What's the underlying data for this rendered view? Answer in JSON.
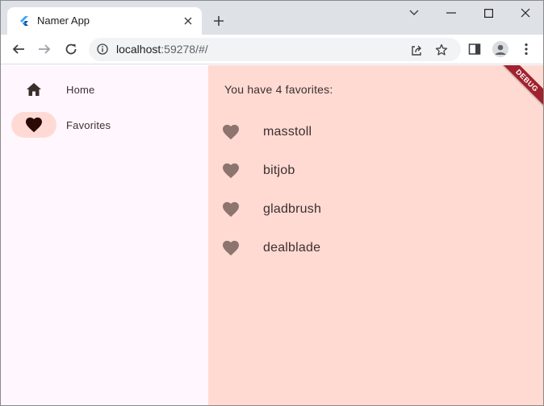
{
  "browser": {
    "tab_title": "Namer App",
    "url_host": "localhost",
    "url_rest": ":59278/#/"
  },
  "icons": {
    "favicon": "flutter-icon",
    "tab_close": "close-icon",
    "new_tab": "plus-icon",
    "minimize": "minimize-icon",
    "maximize": "maximize-icon",
    "close_window": "close-icon",
    "back": "back-arrow-icon",
    "forward": "forward-arrow-icon",
    "reload": "reload-icon",
    "site_info": "info-icon",
    "share": "share-icon",
    "bookmark": "star-icon",
    "side_panel": "side-panel-icon",
    "profile": "profile-icon",
    "menu": "kebab-menu-icon",
    "home": "home-icon",
    "favorites": "heart-icon"
  },
  "rail": {
    "items": [
      {
        "label": "Home",
        "icon": "home-icon",
        "selected": false
      },
      {
        "label": "Favorites",
        "icon": "heart-icon",
        "selected": true
      }
    ]
  },
  "favorites": {
    "count_text": "You have 4 favorites:",
    "items": [
      "masstoll",
      "bitjob",
      "gladbrush",
      "dealblade"
    ]
  },
  "debug_banner": "DEBUG",
  "colors": {
    "rail_bg": "#fff7fd",
    "main_bg": "#ffdad3",
    "indicator": "#ffdad4",
    "heart": "#8d746f",
    "banner": "#a0222e"
  }
}
